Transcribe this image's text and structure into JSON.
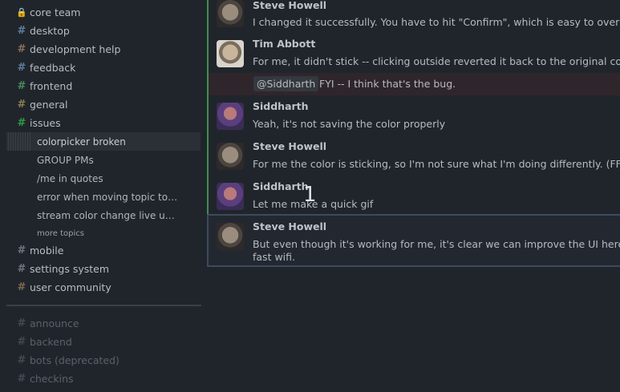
{
  "sidebar": {
    "streams_top": [
      {
        "label": "core team",
        "icon": "lock-icon",
        "color": "#a9a26a"
      },
      {
        "label": "desktop",
        "icon": "hash-icon",
        "color": "#5e7f9e"
      },
      {
        "label": "development help",
        "icon": "hash-icon",
        "color": "#8a6e5b"
      },
      {
        "label": "feedback",
        "icon": "hash-icon",
        "color": "#5e7f9e"
      },
      {
        "label": "frontend",
        "icon": "hash-icon",
        "color": "#4b8a5a"
      },
      {
        "label": "general",
        "icon": "hash-icon",
        "color": "#8a7e52"
      },
      {
        "label": "issues",
        "icon": "hash-icon",
        "color": "#2e9a47"
      }
    ],
    "topics": [
      {
        "label": "colorpicker broken",
        "active": true
      },
      {
        "label": "GROUP PMs"
      },
      {
        "label": "/me in quotes"
      },
      {
        "label": "error when moving topic to …"
      },
      {
        "label": "stream color change live up…"
      }
    ],
    "more_topics": "more topics",
    "streams_bottom": [
      {
        "label": "mobile",
        "icon": "hash-icon",
        "color": "#6f7680"
      },
      {
        "label": "settings system",
        "icon": "hash-icon",
        "color": "#6f7680"
      },
      {
        "label": "user community",
        "icon": "hash-icon",
        "color": "#7b6a4e"
      }
    ],
    "streams_muted": [
      {
        "label": "announce",
        "icon": "hash-icon"
      },
      {
        "label": "backend",
        "icon": "hash-icon"
      },
      {
        "label": "bots (deprecated)",
        "icon": "hash-icon"
      },
      {
        "label": "checkins",
        "icon": "hash-icon"
      }
    ]
  },
  "messages": [
    {
      "sender": "Steve Howell",
      "avatar": "steve",
      "text": "I changed it successfully. You have to hit \"Confirm\", which is easy to overlook in"
    },
    {
      "sender": "Tim Abbott",
      "avatar": "tim",
      "text": "For me, it didn't stick -- clicking outside reverted it back to the original color aft"
    },
    {
      "mention": "@Siddharth",
      "text": "FYI -- I think that's the bug."
    },
    {
      "sender": "Siddharth",
      "avatar": "sid",
      "text": "Yeah, it's not saving the color properly"
    },
    {
      "sender": "Steve Howell",
      "avatar": "steve",
      "text": "For me the color is sticking, so I'm not sure what I'm doing differently. (FF)"
    },
    {
      "sender": "Siddharth",
      "avatar": "sid",
      "text": "Let me make a quick gif"
    },
    {
      "sender": "Steve Howell",
      "avatar": "steve",
      "text": "But even though it's working for me, it's clear we can improve the UI here. It's s",
      "text2": "fast wifi."
    }
  ],
  "overlay_number": "1"
}
